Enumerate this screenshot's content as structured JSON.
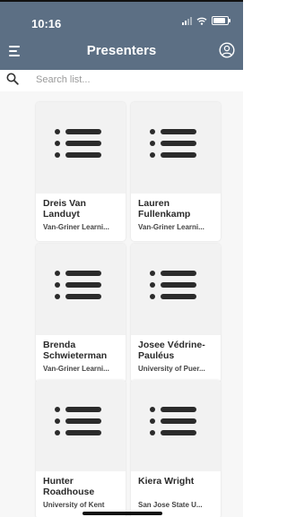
{
  "status_bar": {
    "time": "10:16"
  },
  "header": {
    "title": "Presenters"
  },
  "search": {
    "placeholder": "Search list..."
  },
  "presenters": [
    {
      "name": "Dreis Van Landuyt",
      "organization": "Van-Griner Learni..."
    },
    {
      "name": "Lauren Fullenkamp",
      "organization": "Van-Griner Learni..."
    },
    {
      "name": "Brenda Schwieterman",
      "organization": "Van-Griner Learni..."
    },
    {
      "name": "Josee Védrine-Pauléus",
      "organization": "University of Puer..."
    },
    {
      "name": "Hunter Roadhouse",
      "organization": "University of Kent"
    },
    {
      "name": "Kiera Wright",
      "organization": "San Jose State U..."
    }
  ],
  "colors": {
    "header": "#5c6f84",
    "background": "#f7f7f7",
    "thumbnail": "#f2f2f2",
    "icon": "#2b2b2b"
  },
  "icons": {
    "menu": "menu-icon",
    "account": "account-icon",
    "search": "search-icon",
    "placeholder": "list-icon"
  }
}
